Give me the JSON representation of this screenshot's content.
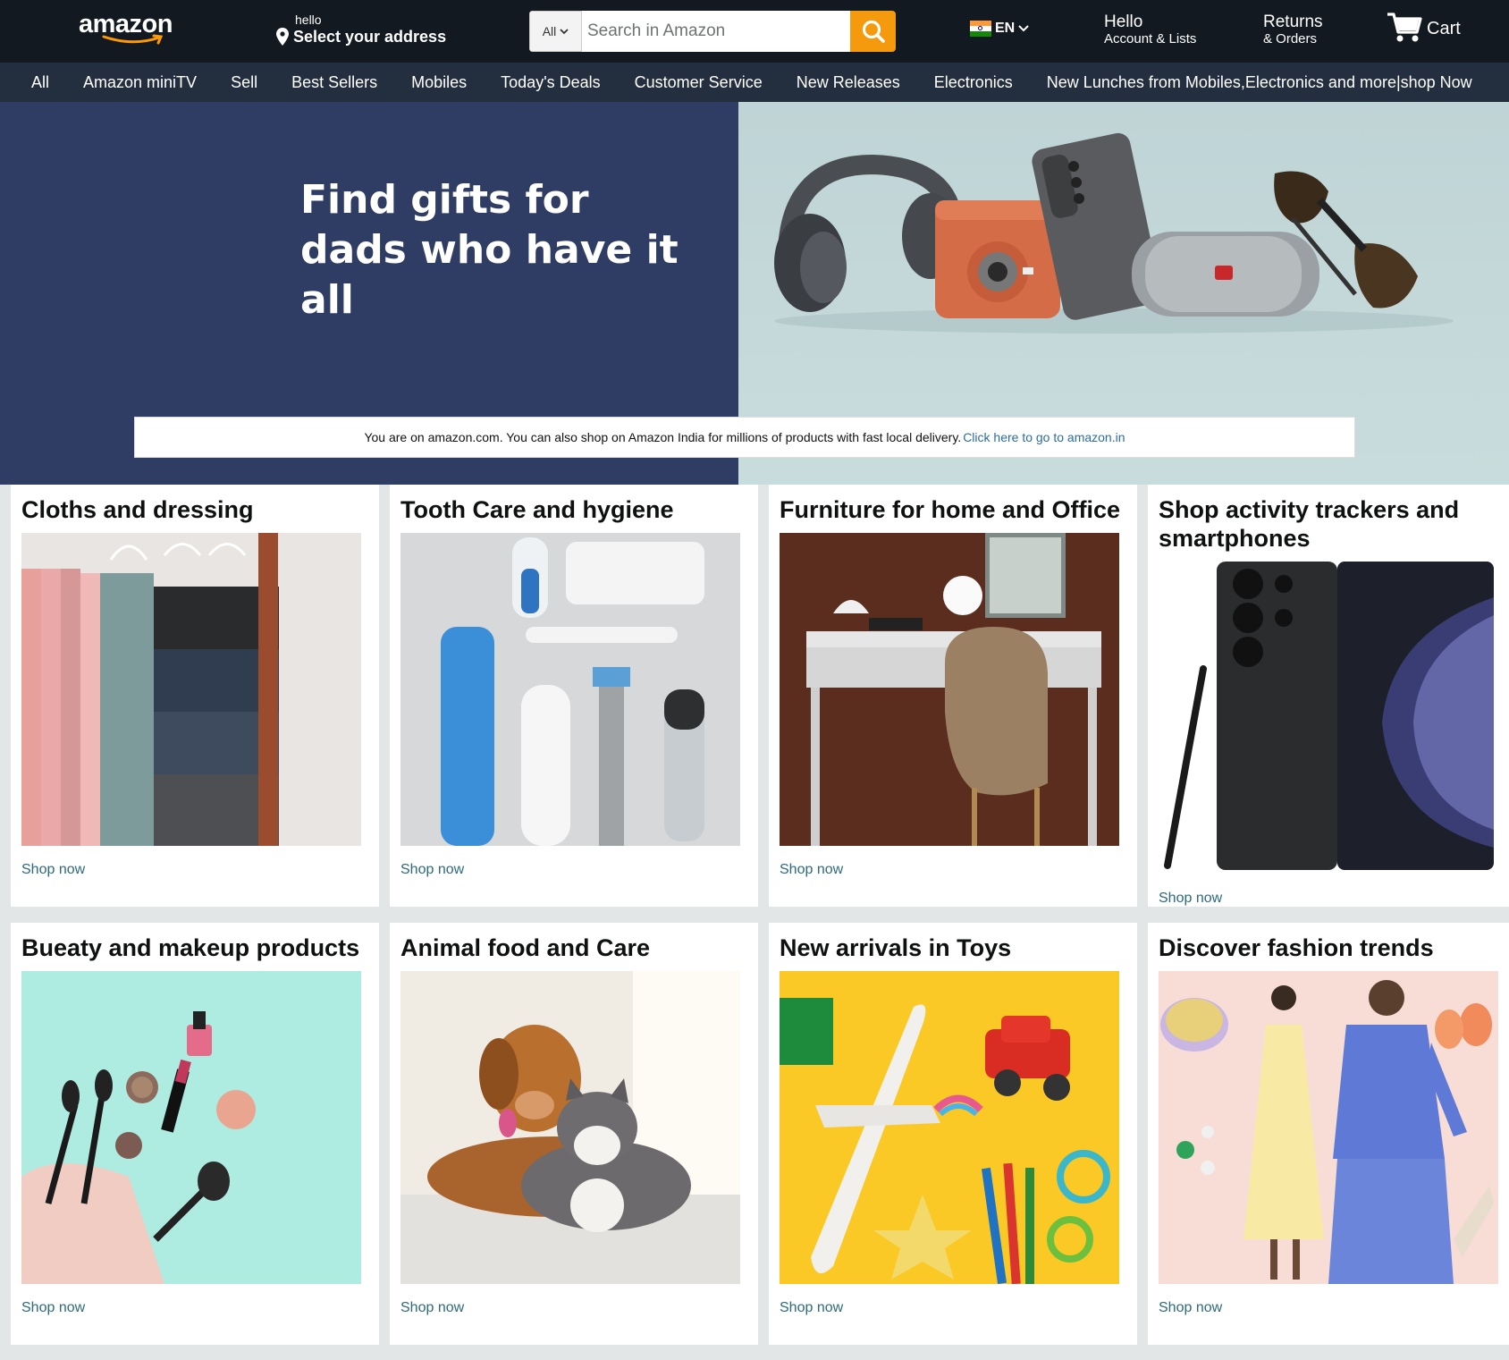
{
  "header": {
    "logo": "amazon",
    "address_hello": "hello",
    "address_select": "Select your address",
    "search_category": "All",
    "search_placeholder": "Search in Amazon",
    "language": "EN",
    "account_l1": "Hello",
    "account_l2": "Account & Lists",
    "returns_l1": "Returns",
    "returns_l2": "& Orders",
    "cart": "Cart"
  },
  "subnav": [
    "All",
    "Amazon miniTV",
    "Sell",
    "Best Sellers",
    "Mobiles",
    "Today's Deals",
    "Customer Service",
    "New Releases",
    "Electronics",
    "New Lunches from Mobiles,Electronics and more|shop Now"
  ],
  "hero": {
    "title_line1": "Find gifts for",
    "title_line2": "dads who have it all",
    "notice_text": "You are on amazon.com. You can also shop on Amazon India for millions of products with fast local delivery.",
    "notice_link": "Click here to go to amazon.in"
  },
  "cards": [
    {
      "title": "Cloths and dressing",
      "cta": "Shop now"
    },
    {
      "title": "Tooth Care and hygiene",
      "cta": "Shop now"
    },
    {
      "title": "Furniture for home and Office",
      "cta": "Shop now"
    },
    {
      "title": "Shop activity trackers and smartphones",
      "cta": "Shop now"
    },
    {
      "title": "Bueaty and makeup products",
      "cta": "Shop now"
    },
    {
      "title": "Animal food and Care",
      "cta": "Shop now"
    },
    {
      "title": "New arrivals in Toys",
      "cta": "Shop now"
    },
    {
      "title": "Discover fashion trends",
      "cta": "Shop now"
    }
  ],
  "colors": {
    "header": "#131921",
    "subnav": "#232f3e",
    "hero_left": "#2f3c63",
    "search_button": "#f59a0c",
    "link": "#2c6a7d"
  }
}
